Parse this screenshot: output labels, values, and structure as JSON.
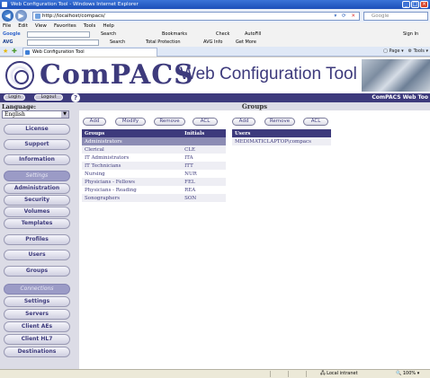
{
  "window": {
    "title": "Web Configuration Tool - Windows Internet Explorer",
    "address": "http://localhost/compacs/",
    "search_placeholder": "Google"
  },
  "menu": [
    "File",
    "Edit",
    "View",
    "Favorites",
    "Tools",
    "Help"
  ],
  "toolbar1": {
    "brand": "Google",
    "search": "Search",
    "bookmarks": "Bookmarks",
    "check": "Check",
    "autofill": "AutoFill",
    "signin": "Sign In"
  },
  "toolbar2": {
    "brand": "AVG",
    "search": "Search",
    "protection": "Total Protection",
    "avg_info": "AVG Info",
    "get_more": "Get More"
  },
  "tab": {
    "label": "Web Configuration Tool",
    "page": "Page",
    "tools": "Tools"
  },
  "banner": {
    "logo": "ComPACS",
    "title": "Web Configuration Tool",
    "right_label": "ComPACS Web Too"
  },
  "header": {
    "login": "Login",
    "logout": "Logout",
    "help": "?"
  },
  "sidebar": {
    "language_label": "Language:",
    "language_value": "English",
    "items": [
      "License",
      "Support",
      "Information",
      "Settings",
      "Administration",
      "Security",
      "Volumes",
      "Templates",
      "Profiles",
      "Users",
      "Groups",
      "Connections",
      "Settings",
      "Servers",
      "Client AEs",
      "Client HL7",
      "Destinations"
    ]
  },
  "main": {
    "heading": "Groups",
    "group_buttons": [
      "Add",
      "Modify",
      "Remove",
      "ACL"
    ],
    "user_buttons": [
      "Add",
      "Remove",
      "ACL"
    ],
    "groups_table": {
      "headers": [
        "Groups",
        "Initials"
      ],
      "rows": [
        [
          "Administrators",
          ""
        ],
        [
          "Clerical",
          "CLE"
        ],
        [
          "IT Administrators",
          "ITA"
        ],
        [
          "IT Technicians",
          "ITT"
        ],
        [
          "Nursing",
          "NUR"
        ],
        [
          "Physicians - Fellows",
          "FEL"
        ],
        [
          "Physicians - Reading",
          "REA"
        ],
        [
          "Sonographers",
          "SON"
        ]
      ]
    },
    "users_table": {
      "headers": [
        "Users"
      ],
      "rows": [
        "MEDIMATICLAPTOP\\compacs"
      ]
    }
  },
  "status": {
    "zone": "Local intranet",
    "zoom": "100%"
  }
}
